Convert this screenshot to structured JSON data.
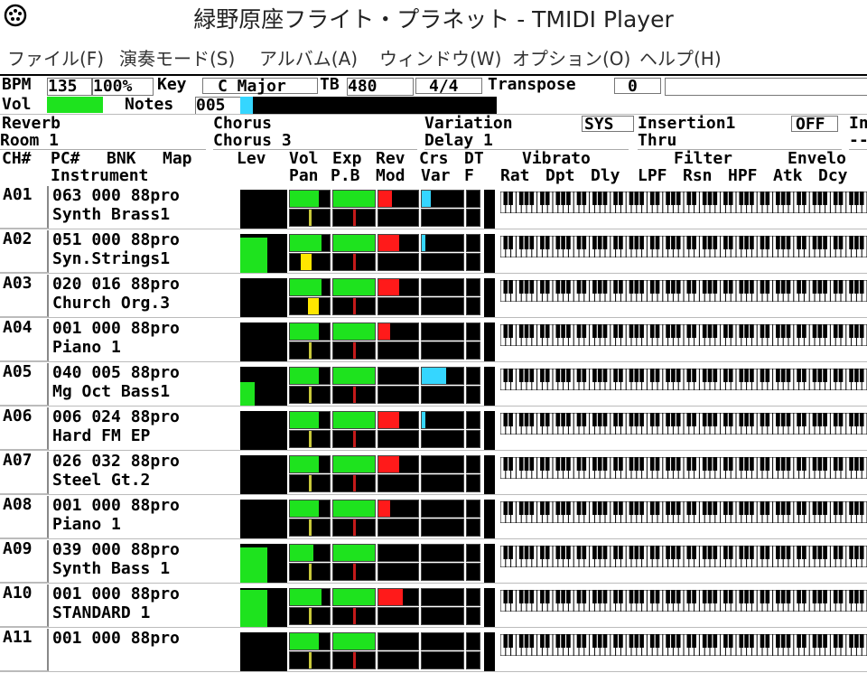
{
  "window": {
    "title": "緑野原座フライト・プラネット - TMIDI Player"
  },
  "menu": [
    "ファイル(F)",
    "演奏モード(S)",
    "アルバム(A)",
    "ウィンドウ(W)",
    "オプション(O)",
    "ヘルプ(H)"
  ],
  "status": {
    "bpm_label": "BPM",
    "bpm": "135",
    "tempo_pct": "100%",
    "key_label": "Key",
    "key": "C Major",
    "tb_label": "TB",
    "tb": "480",
    "time_sig": "4/4",
    "transpose_label": "Transpose",
    "transpose": "0",
    "vol_label": "Vol",
    "notes_label": "Notes",
    "notes": "005",
    "vol_level": 0.78,
    "notes_level": 0.05
  },
  "effects": {
    "reverb_label": "Reverb",
    "reverb": "Room 1",
    "chorus_label": "Chorus",
    "chorus": "Chorus 3",
    "variation_label": "Variation",
    "variation_mode": "SYS",
    "variation": "Delay 1",
    "insertion_label": "Insertion1",
    "insertion_state": "OFF",
    "insertion": "Thru",
    "insertion2_label": "In",
    "insertion2": "--"
  },
  "headers": {
    "ch": "CH#",
    "pc": "PC#",
    "bnk": "BNK",
    "map": "Map",
    "instrument": "Instrument",
    "lev": "Lev",
    "vol": "Vol",
    "exp": "Exp",
    "rev": "Rev",
    "crs": "Crs",
    "dt": "DT",
    "pan": "Pan",
    "pb": "P.B",
    "mod": "Mod",
    "var": "Var",
    "f": "F",
    "vibrato": "Vibrato",
    "filter": "Filter",
    "envelope": "Envelo",
    "rat": "Rat",
    "dpt": "Dpt",
    "dly": "Dly",
    "lpf": "LPF",
    "rsn": "Rsn",
    "hpf": "HPF",
    "atk": "Atk",
    "dcy": "Dcy"
  },
  "channels": [
    {
      "ch": "A01",
      "line1": "063 000 88pro",
      "name": "Synth Brass1",
      "lev": 0.0,
      "vol": 0.72,
      "exp": 1.0,
      "rev": 0.35,
      "crs": 0.22,
      "pan": 0.5,
      "pb": 0.5
    },
    {
      "ch": "A02",
      "line1": "051 000 88pro",
      "name": "Syn.Strings1",
      "lev": 0.92,
      "vol": 0.8,
      "exp": 1.0,
      "rev": 0.52,
      "crs": 0.08,
      "pan": 0.42,
      "pb": 0.5,
      "pan_active": true
    },
    {
      "ch": "A03",
      "line1": "020 016 88pro",
      "name": "Church Org.3",
      "lev": 0.0,
      "vol": 0.8,
      "exp": 1.0,
      "rev": 0.52,
      "crs": 0.0,
      "pan": 0.58,
      "pb": 0.5,
      "pan_active": true
    },
    {
      "ch": "A04",
      "line1": "001 000 88pro",
      "name": "Piano 1",
      "lev": 0.0,
      "vol": 0.72,
      "exp": 1.0,
      "rev": 0.3,
      "crs": 0.0,
      "pan": 0.5,
      "pb": 0.5
    },
    {
      "ch": "A05",
      "line1": "040 005 88pro",
      "name": "Mg Oct Bass1",
      "lev": 0.62,
      "vol": 0.72,
      "exp": 1.0,
      "rev": 0.0,
      "crs": 0.58,
      "pan": 0.5,
      "pb": 0.5
    },
    {
      "ch": "A06",
      "line1": "006 024 88pro",
      "name": "Hard FM EP",
      "lev": 0.0,
      "vol": 0.72,
      "exp": 1.0,
      "rev": 0.52,
      "crs": 0.08,
      "pan": 0.5,
      "pb": 0.5
    },
    {
      "ch": "A07",
      "line1": "026 032 88pro",
      "name": "Steel Gt.2",
      "lev": 0.0,
      "vol": 0.72,
      "exp": 1.0,
      "rev": 0.52,
      "crs": 0.0,
      "pan": 0.5,
      "pb": 0.5
    },
    {
      "ch": "A08",
      "line1": "001 000 88pro",
      "name": "Piano 1",
      "lev": 0.0,
      "vol": 0.72,
      "exp": 1.0,
      "rev": 0.3,
      "crs": 0.0,
      "pan": 0.5,
      "pb": 0.5
    },
    {
      "ch": "A09",
      "line1": "039 000 88pro",
      "name": "Synth Bass 1",
      "lev": 0.92,
      "vol": 0.6,
      "exp": 1.0,
      "rev": 0.0,
      "crs": 0.0,
      "pan": 0.5,
      "pb": 0.5
    },
    {
      "ch": "A10",
      "line1": "001 000 88pro",
      "name": "STANDARD 1",
      "lev": 0.95,
      "vol": 0.8,
      "exp": 1.0,
      "rev": 0.62,
      "crs": 0.0,
      "pan": 0.5,
      "pb": 0.5
    },
    {
      "ch": "A11",
      "line1": "001 000 88pro",
      "name": "",
      "lev": 0.0,
      "vol": 0.72,
      "exp": 1.0,
      "rev": 0.0,
      "crs": 0.0,
      "pan": 0.5,
      "pb": 0.5
    }
  ],
  "colors": {
    "green": "#1ee31e",
    "red": "#ff1a1a",
    "cyan": "#35d6ff",
    "yellow": "#ffe600",
    "indicator": "#c8c83a"
  }
}
